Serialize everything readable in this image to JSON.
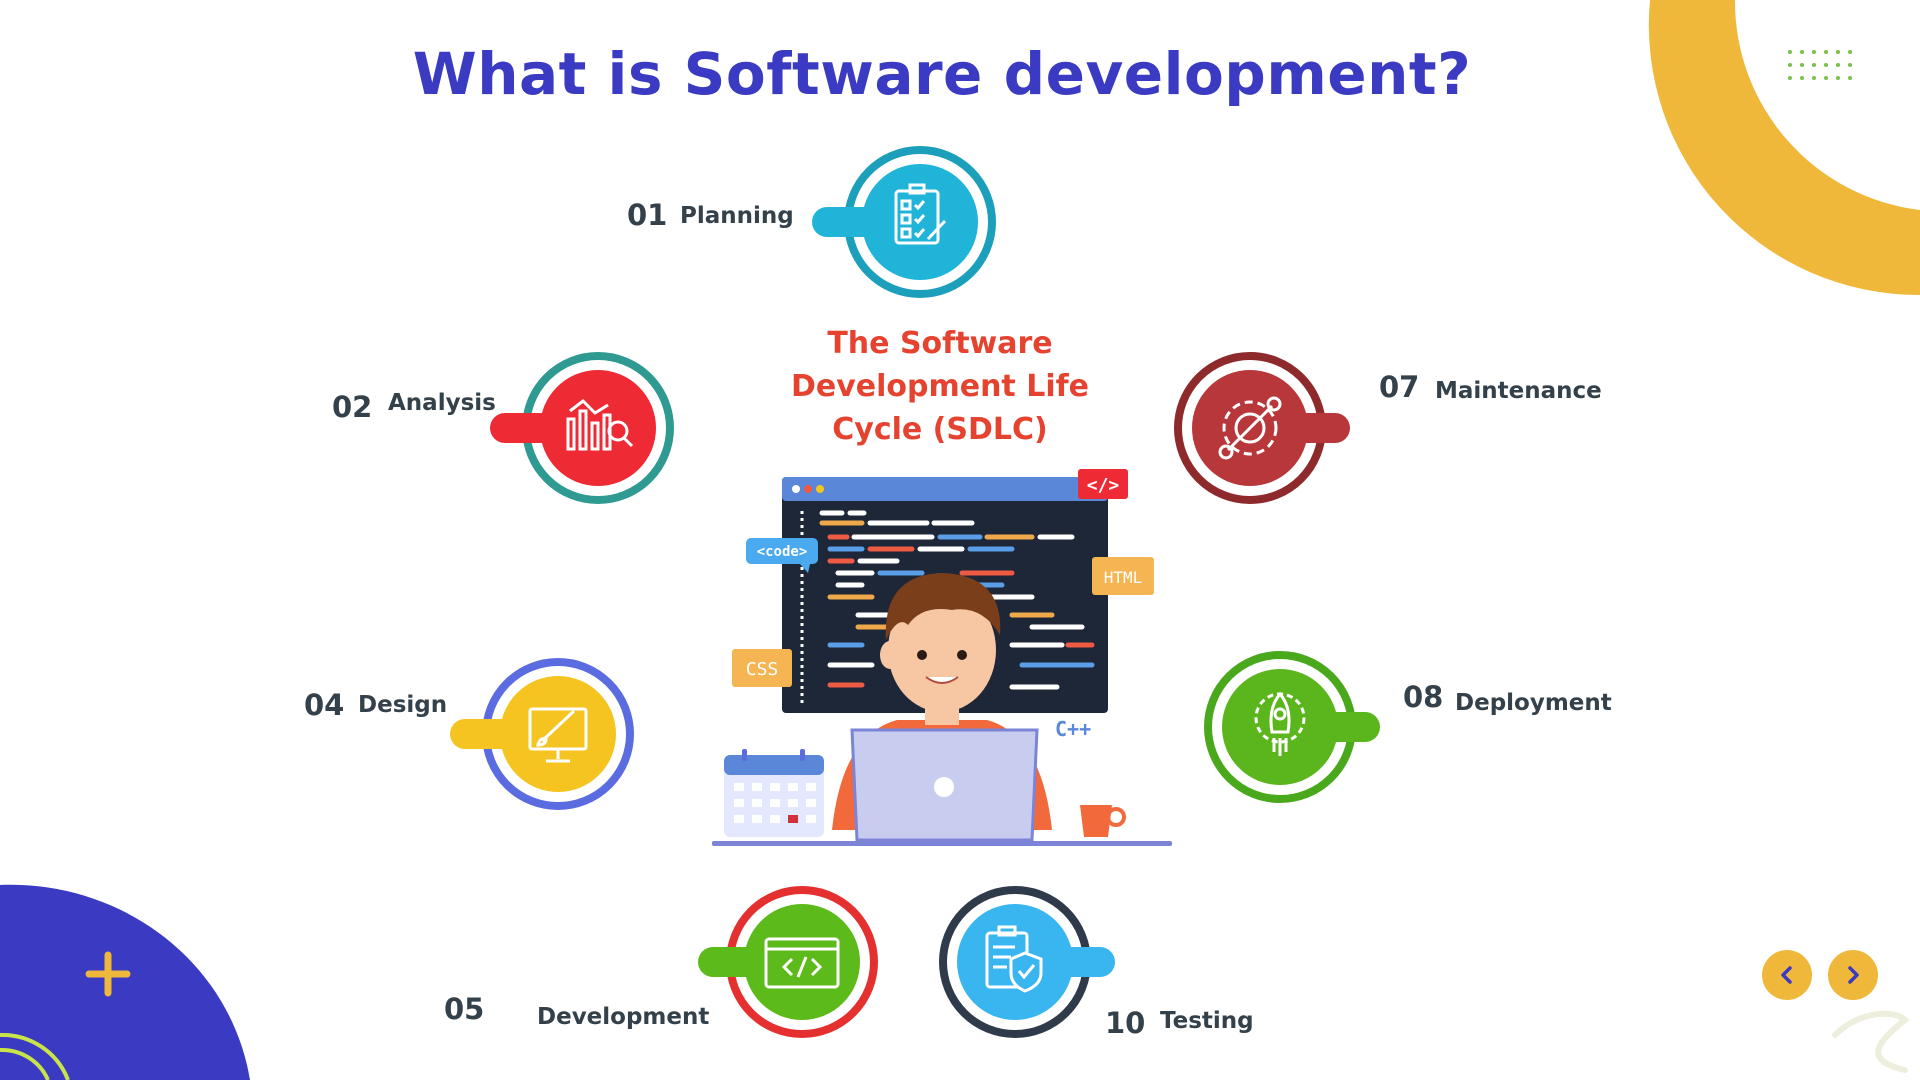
{
  "slide": {
    "title": "What is Software development?",
    "center_title": "The Software Development Life Cycle (SDLC)"
  },
  "stages": [
    {
      "number": "01",
      "label": "Planning",
      "icon": "checklist-icon"
    },
    {
      "number": "02",
      "label": "Analysis",
      "icon": "analytics-chart-icon"
    },
    {
      "number": "04",
      "label": "Design",
      "icon": "design-brush-icon"
    },
    {
      "number": "05",
      "label": "Development",
      "icon": "code-window-icon"
    },
    {
      "number": "10",
      "label": "Testing",
      "icon": "clipboard-shield-icon"
    },
    {
      "number": "08",
      "label": "Deployment",
      "icon": "rocket-gear-icon"
    },
    {
      "number": "07",
      "label": "Maintenance",
      "icon": "gear-wrench-icon"
    }
  ],
  "illustration": {
    "tags": {
      "code": "<code>",
      "html": "HTML",
      "css": "CSS",
      "cpp": "C++",
      "brackets": "</>"
    }
  },
  "colors": {
    "title": "#3a3ac2",
    "sdlc_title": "#e5432f",
    "planning": "#1fb4d8",
    "analysis": "#ee2a35",
    "design": "#f6c420",
    "development": "#5dba1b",
    "testing": "#39b6f0",
    "deployment": "#5bb61e",
    "maintenance": "#b8373a",
    "accent_yellow": "#f0b83a",
    "accent_blue": "#3a3ac2"
  },
  "navigation": {
    "prev_icon": "chevron-left-icon",
    "next_icon": "chevron-right-icon"
  }
}
